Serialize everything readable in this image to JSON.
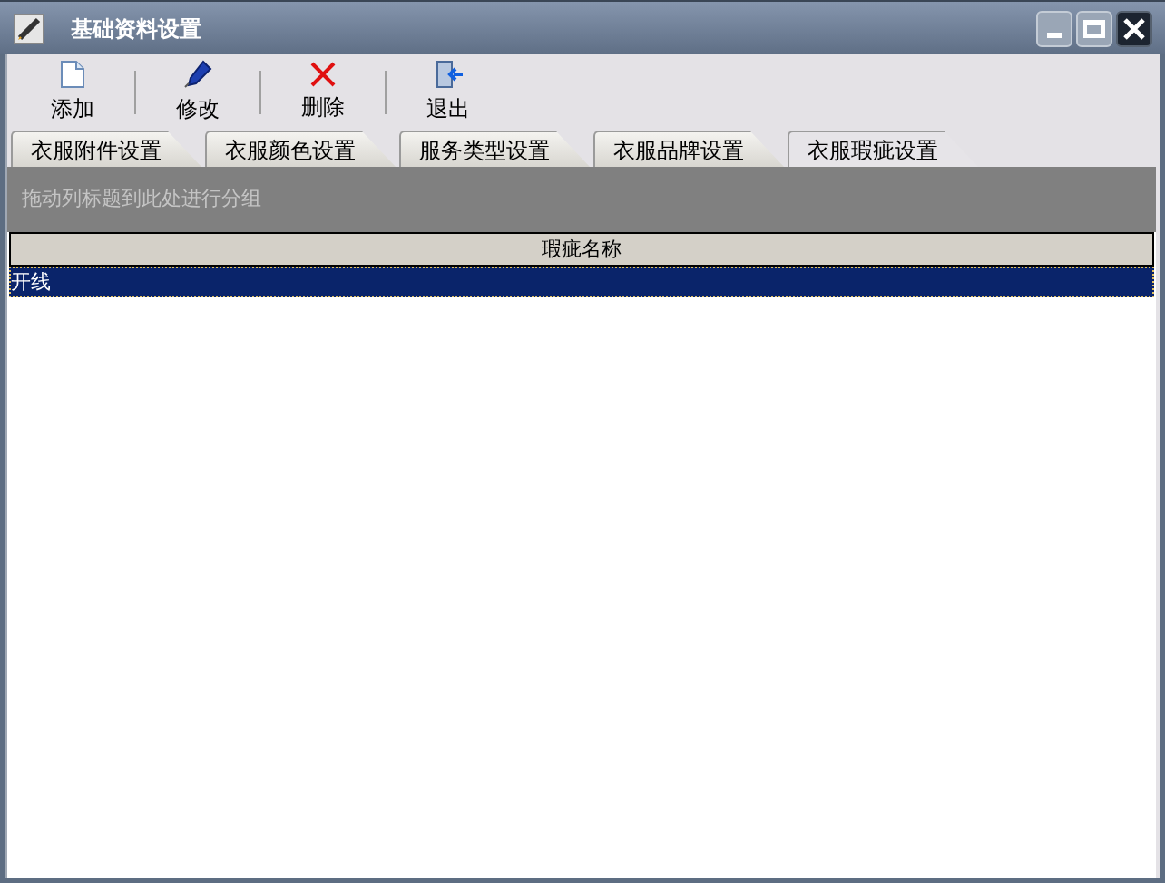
{
  "window": {
    "title": "基础资料设置"
  },
  "toolbar": [
    {
      "kind": "add",
      "label": "添加"
    },
    {
      "kind": "edit",
      "label": "修改"
    },
    {
      "kind": "delete",
      "label": "删除"
    },
    {
      "kind": "exit",
      "label": "退出"
    }
  ],
  "tabs": [
    {
      "label": "衣服附件设置",
      "selected": false
    },
    {
      "label": "衣服颜色设置",
      "selected": false
    },
    {
      "label": "服务类型设置",
      "selected": false
    },
    {
      "label": "衣服品牌设置",
      "selected": false
    },
    {
      "label": "衣服瑕疵设置",
      "selected": true
    }
  ],
  "group_panel": {
    "hint": "拖动列标题到此处进行分组"
  },
  "table": {
    "columns": [
      "瑕疵名称"
    ],
    "rows": [
      {
        "cells": [
          "开线"
        ],
        "selected": true
      }
    ]
  }
}
